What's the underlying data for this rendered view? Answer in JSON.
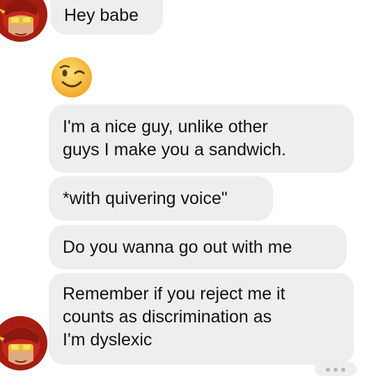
{
  "conversation": {
    "messages": [
      {
        "lines": [
          "Hey babe"
        ]
      },
      {
        "emoji": "winking-face"
      },
      {
        "lines": [
          "I'm a nice guy, unlike other",
          "guys I make you a sandwich."
        ]
      },
      {
        "lines": [
          "*with quivering voice\""
        ]
      },
      {
        "lines": [
          "Do you wanna go out with me"
        ]
      },
      {
        "lines": [
          "Remember if you reject me it",
          "counts as discrimination as",
          "I'm dyslexic"
        ]
      }
    ]
  },
  "colors": {
    "bubble_bg": "#eeeef0",
    "text": "#121212",
    "avatar_red": "#a51d12",
    "emoji_yellow": "#f6c43a"
  }
}
